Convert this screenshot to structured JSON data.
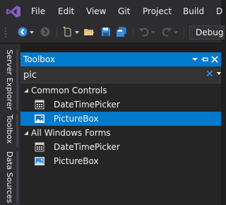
{
  "menu": {
    "logo": "visual-studio-logo",
    "items": [
      {
        "label": "File"
      },
      {
        "label": "Edit"
      },
      {
        "label": "View"
      },
      {
        "label": "Git"
      },
      {
        "label": "Project"
      },
      {
        "label": "Build"
      },
      {
        "label": "D"
      }
    ]
  },
  "toolbar": {
    "icons": [
      "back-icon",
      "forward-icon",
      "new-item-icon",
      "open-folder-icon",
      "save-icon",
      "save-all-icon",
      "undo-icon",
      "redo-icon"
    ],
    "config_combo": "Debug"
  },
  "side_tabs": [
    {
      "label": "Server Explorer"
    },
    {
      "label": "Toolbox"
    },
    {
      "label": "Data Sources"
    }
  ],
  "toolbox": {
    "title": "Toolbox",
    "title_buttons": [
      "window-position-icon",
      "pin-icon",
      "close-icon"
    ],
    "search": {
      "value": "pic",
      "clear_glyph": "✕"
    },
    "groups": [
      {
        "label": "Common Controls",
        "expanded": true,
        "items": [
          {
            "label": "DateTimePicker",
            "icon": "datetimepicker-icon",
            "selected": false
          },
          {
            "label": "PictureBox",
            "icon": "picturebox-icon",
            "selected": true
          }
        ]
      },
      {
        "label": "All Windows Forms",
        "expanded": true,
        "items": [
          {
            "label": "DateTimePicker",
            "icon": "datetimepicker-icon",
            "selected": false
          },
          {
            "label": "PictureBox",
            "icon": "picturebox-icon",
            "selected": false
          }
        ]
      }
    ]
  },
  "colors": {
    "accent": "#007acc",
    "background": "#1e1e1e",
    "chrome": "#2d2d30",
    "panel": "#252526",
    "logo": "#8661c5",
    "clear_button": "#3399ff"
  }
}
